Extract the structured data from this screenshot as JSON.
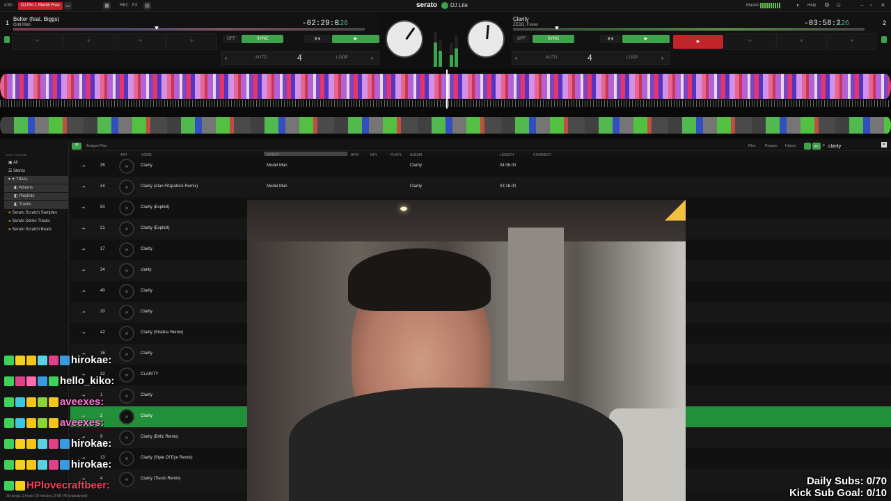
{
  "topbar": {
    "clock": "4:50",
    "promo": "DJ Pro 1 Month Free",
    "menu_rec": "REC",
    "menu_fx": "FX",
    "brand": "serato",
    "product": "DJ Lite",
    "master_label": "Master",
    "help_label": "Help"
  },
  "deck_left": {
    "number": "1",
    "title": "Belter (feat. Biggs)",
    "artist": "Odd Mob",
    "time": "-02:29:0",
    "bpm": "126",
    "off": "OFF",
    "sync": "SYNC",
    "auto": "AUTO",
    "beats": "4",
    "loop": "LOOP"
  },
  "deck_right": {
    "number": "2",
    "title": "Clarity",
    "artist": "ZEDD, Foxes",
    "time": "-03:58:2",
    "bpm": "126",
    "off": "OFF",
    "sync": "SYNC",
    "auto": "AUTO",
    "beats": "4",
    "loop": "LOOP"
  },
  "sidebar": {
    "header": "SORT: CUSTOM",
    "items": [
      {
        "label": "All"
      },
      {
        "label": "Stems"
      },
      {
        "label": "TIDAL"
      },
      {
        "label": "Albums"
      },
      {
        "label": "Playlists"
      },
      {
        "label": "Tracks"
      },
      {
        "label": "Serato Scratch Samples"
      },
      {
        "label": "Serato Demo Tracks"
      },
      {
        "label": "Serato Scratch Beats"
      }
    ]
  },
  "browser": {
    "analyze_files": "Analyze Files",
    "files": "Files",
    "prepare": "Prepare",
    "history": "History",
    "all_tag": "ALL",
    "search_value": "clarity",
    "columns": {
      "art": "ART",
      "song": "SONG",
      "artist": "ARTIST",
      "bpm": "BPM",
      "key": "KEY",
      "plays": "PLAYS",
      "album": "ALBUM",
      "length": "LENGTH",
      "comment": "COMMENT"
    },
    "status": "30 songs, 3 hours 20 minutes, 0 KB (49 unanalyzed)"
  },
  "tracks": [
    {
      "num": "35",
      "song": "Clarity",
      "artist": "Model Man",
      "album": "Clarity",
      "length": "04:06.00"
    },
    {
      "num": "44",
      "song": "Clarity (Alan Fitzpatrick Remix)",
      "artist": "Model Man",
      "album": "Clarity",
      "length": "03:16.00"
    },
    {
      "num": "50",
      "song": "Clarity (Explicit)",
      "artist": "",
      "album": "",
      "length": ""
    },
    {
      "num": "21",
      "song": "Clarity (Explicit)",
      "artist": "",
      "album": "",
      "length": ""
    },
    {
      "num": "17",
      "song": "Clarity",
      "artist": "",
      "album": "",
      "length": ""
    },
    {
      "num": "34",
      "song": "clarity",
      "artist": "",
      "album": "",
      "length": ""
    },
    {
      "num": "40",
      "song": "Clarity",
      "artist": "",
      "album": "",
      "length": ""
    },
    {
      "num": "20",
      "song": "Clarity",
      "artist": "",
      "album": "",
      "length": ""
    },
    {
      "num": "42",
      "song": "Clarity (Shallou Remix)",
      "artist": "",
      "album": "",
      "length": ""
    },
    {
      "num": "16",
      "song": "Clarity",
      "artist": "",
      "album": "",
      "length": ""
    },
    {
      "num": "32",
      "song": "CLARITY",
      "artist": "",
      "album": "",
      "length": ""
    },
    {
      "num": "1",
      "song": "Clarity",
      "artist": "",
      "album": "",
      "length": ""
    },
    {
      "num": "2",
      "song": "Clarity",
      "artist": "",
      "album": "",
      "length": ""
    },
    {
      "num": "9",
      "song": "Clarity (Brillz Remix)",
      "artist": "",
      "album": "",
      "length": ""
    },
    {
      "num": "13",
      "song": "Clarity (Style Of Eye Remix)",
      "artist": "",
      "album": "",
      "length": ""
    },
    {
      "num": "4",
      "song": "Clarity (Tiesto Remix)",
      "artist": "",
      "album": "",
      "length": ""
    }
  ],
  "chat": [
    {
      "name": "hirokae:",
      "color": "#ffffff"
    },
    {
      "name": "hello_kiko:",
      "color": "#ffffff"
    },
    {
      "name": "aveexes:",
      "color": "#ff7bd5"
    },
    {
      "name": "aveexes:",
      "color": "#ff7bd5"
    },
    {
      "name": "hirokae:",
      "color": "#ffffff"
    },
    {
      "name": "hirokae:",
      "color": "#ffffff"
    },
    {
      "name": "HPlovecraftbeer:",
      "color": "#ff3b5c"
    }
  ],
  "overlay": {
    "daily_subs": "Daily Subs: 0/70",
    "kick_goal": "Kick Sub Goal: 0/10"
  },
  "colors": {
    "accent_green": "#3fa24c",
    "promo_red": "#c3242a",
    "selected_row": "#22903a"
  }
}
